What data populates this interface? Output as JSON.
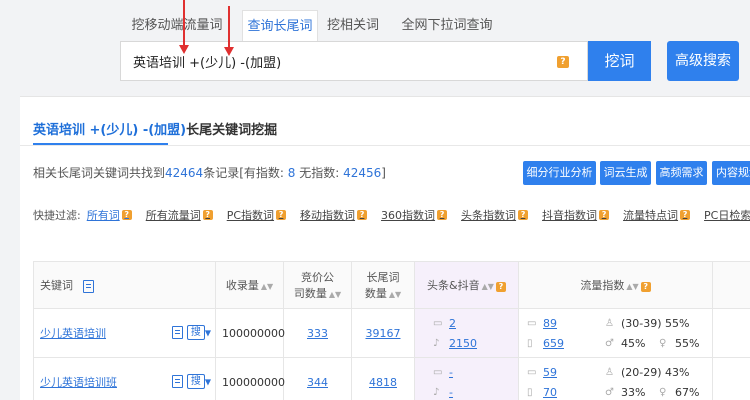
{
  "tabs": [
    "挖移动端流量词",
    "查询长尾词",
    "挖相关词",
    "全网下拉词查询"
  ],
  "search": {
    "value": "英语培训 +(少儿) -(加盟)",
    "help": "?"
  },
  "buttons": {
    "dig": "挖词",
    "advanced": "高级搜索"
  },
  "panel": {
    "title_keyword": "英语培训 +(少儿) -(加盟)",
    "title_suffix": "长尾关键词挖掘",
    "summary_prefix": "相关长尾词关键词共找到",
    "summary_total": "42464",
    "summary_mid": "条记录[有指数:",
    "summary_with": "8",
    "summary_without_label": "无指数:",
    "summary_without": "42456",
    "summary_end": "]",
    "actions": [
      "细分行业分析",
      "词云生成",
      "高频需求",
      "内容规划"
    ]
  },
  "filters": {
    "label": "快捷过滤:",
    "items": [
      "所有词",
      "所有流量词",
      "PC指数词",
      "移动指数词",
      "360指数词",
      "头条指数词",
      "抖音指数词",
      "流量特点词",
      "PC日检索量词"
    ]
  },
  "table": {
    "headers": {
      "keyword": "关键词",
      "indexed": "收录量",
      "bid_1": "竞价公",
      "bid_2": "司数量",
      "longtail_1": "长尾词",
      "longtail_2": "数量",
      "toutiao": "头条&抖音",
      "flow": "流量指数"
    },
    "rows": [
      {
        "keyword": "少儿英语培训",
        "search_btn": "搜",
        "indexed": "100000000",
        "bid": "333",
        "longtail": "39167",
        "tt": "2",
        "dy": "2150",
        "pc": "89",
        "mobile": "659",
        "age": "(30-39) 55%",
        "male": "45%",
        "female": "55%"
      },
      {
        "keyword": "少儿英语培训班",
        "search_btn": "搜",
        "indexed": "100000000",
        "bid": "344",
        "longtail": "4818",
        "tt": "-",
        "dy": "-",
        "pc": "59",
        "mobile": "70",
        "age": "(20-29) 43%",
        "male": "33%",
        "female": "67%"
      }
    ]
  },
  "colors": {
    "accent": "#2f80ed",
    "link": "#2f74d8",
    "help_badge": "#f0a030",
    "annotation_arrow": "#e03030"
  }
}
